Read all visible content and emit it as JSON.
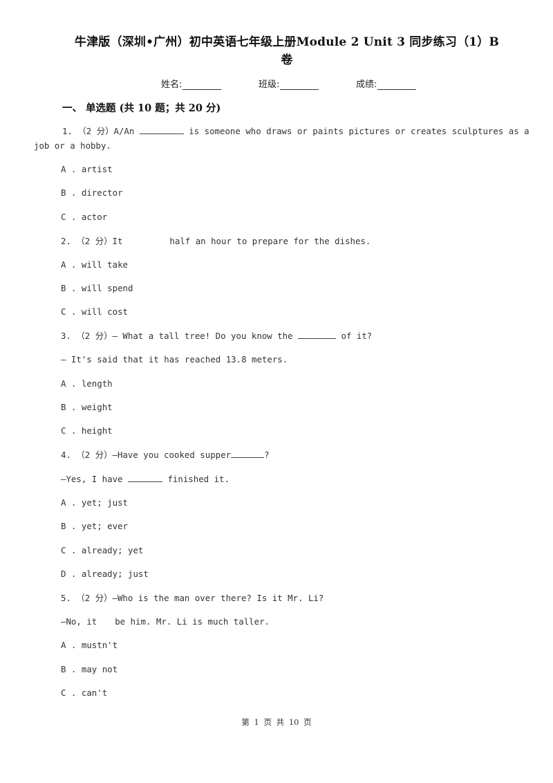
{
  "document": {
    "title_line1": "牛津版（深圳•广州）初中英语七年级上册Module 2 Unit 3 同步练习（1）B",
    "title_line2": "卷",
    "info": {
      "name_label": "姓名:",
      "class_label": "班级:",
      "score_label": "成绩:"
    },
    "section_heading": "一、 单选题 (共 10 题；共 20 分)",
    "questions": [
      {
        "number": "1.",
        "points": "（2 分）",
        "stem_before": "A/An ",
        "stem_after": " is someone who draws or paints pictures or creates sculptures as a",
        "stem_continued": "job or a hobby.",
        "options": [
          {
            "letter": "A .",
            "text": "artist"
          },
          {
            "letter": "B .",
            "text": "director"
          },
          {
            "letter": "C .",
            "text": "actor"
          }
        ]
      },
      {
        "number": "2.",
        "points": "（2 分）",
        "stem_before": "It",
        "stem_after": "half an hour to prepare for the dishes.",
        "options": [
          {
            "letter": "A .",
            "text": "will take"
          },
          {
            "letter": "B .",
            "text": "will spend"
          },
          {
            "letter": "C .",
            "text": "will cost"
          }
        ]
      },
      {
        "number": "3.",
        "points": "（2 分）",
        "stem_before": "— What a tall tree! Do you know the ",
        "stem_after": " of it?",
        "stem_line2": "— It's said that it has reached 13.8 meters.",
        "options": [
          {
            "letter": "A .",
            "text": "length"
          },
          {
            "letter": "B .",
            "text": "weight"
          },
          {
            "letter": "C .",
            "text": "height"
          }
        ]
      },
      {
        "number": "4.",
        "points": "（2 分）",
        "stem_before": "—Have you cooked supper",
        "stem_after": "?",
        "stem_line2_before": "—Yes, I have ",
        "stem_line2_after": " finished it.",
        "options": [
          {
            "letter": "A .",
            "text": "yet; just"
          },
          {
            "letter": "B .",
            "text": "yet; ever"
          },
          {
            "letter": "C .",
            "text": "already; yet"
          },
          {
            "letter": "D .",
            "text": "already; just"
          }
        ]
      },
      {
        "number": "5.",
        "points": "（2 分）",
        "stem_before": "—Who is the man over there? Is it Mr. Li?",
        "stem_line2_before": "—No, it",
        "stem_line2_after": "be him. Mr. Li is much taller.",
        "options": [
          {
            "letter": "A .",
            "text": "mustn't"
          },
          {
            "letter": "B .",
            "text": "may not"
          },
          {
            "letter": "C .",
            "text": "can't"
          }
        ]
      }
    ],
    "footer": "第 1 页 共 10 页"
  }
}
